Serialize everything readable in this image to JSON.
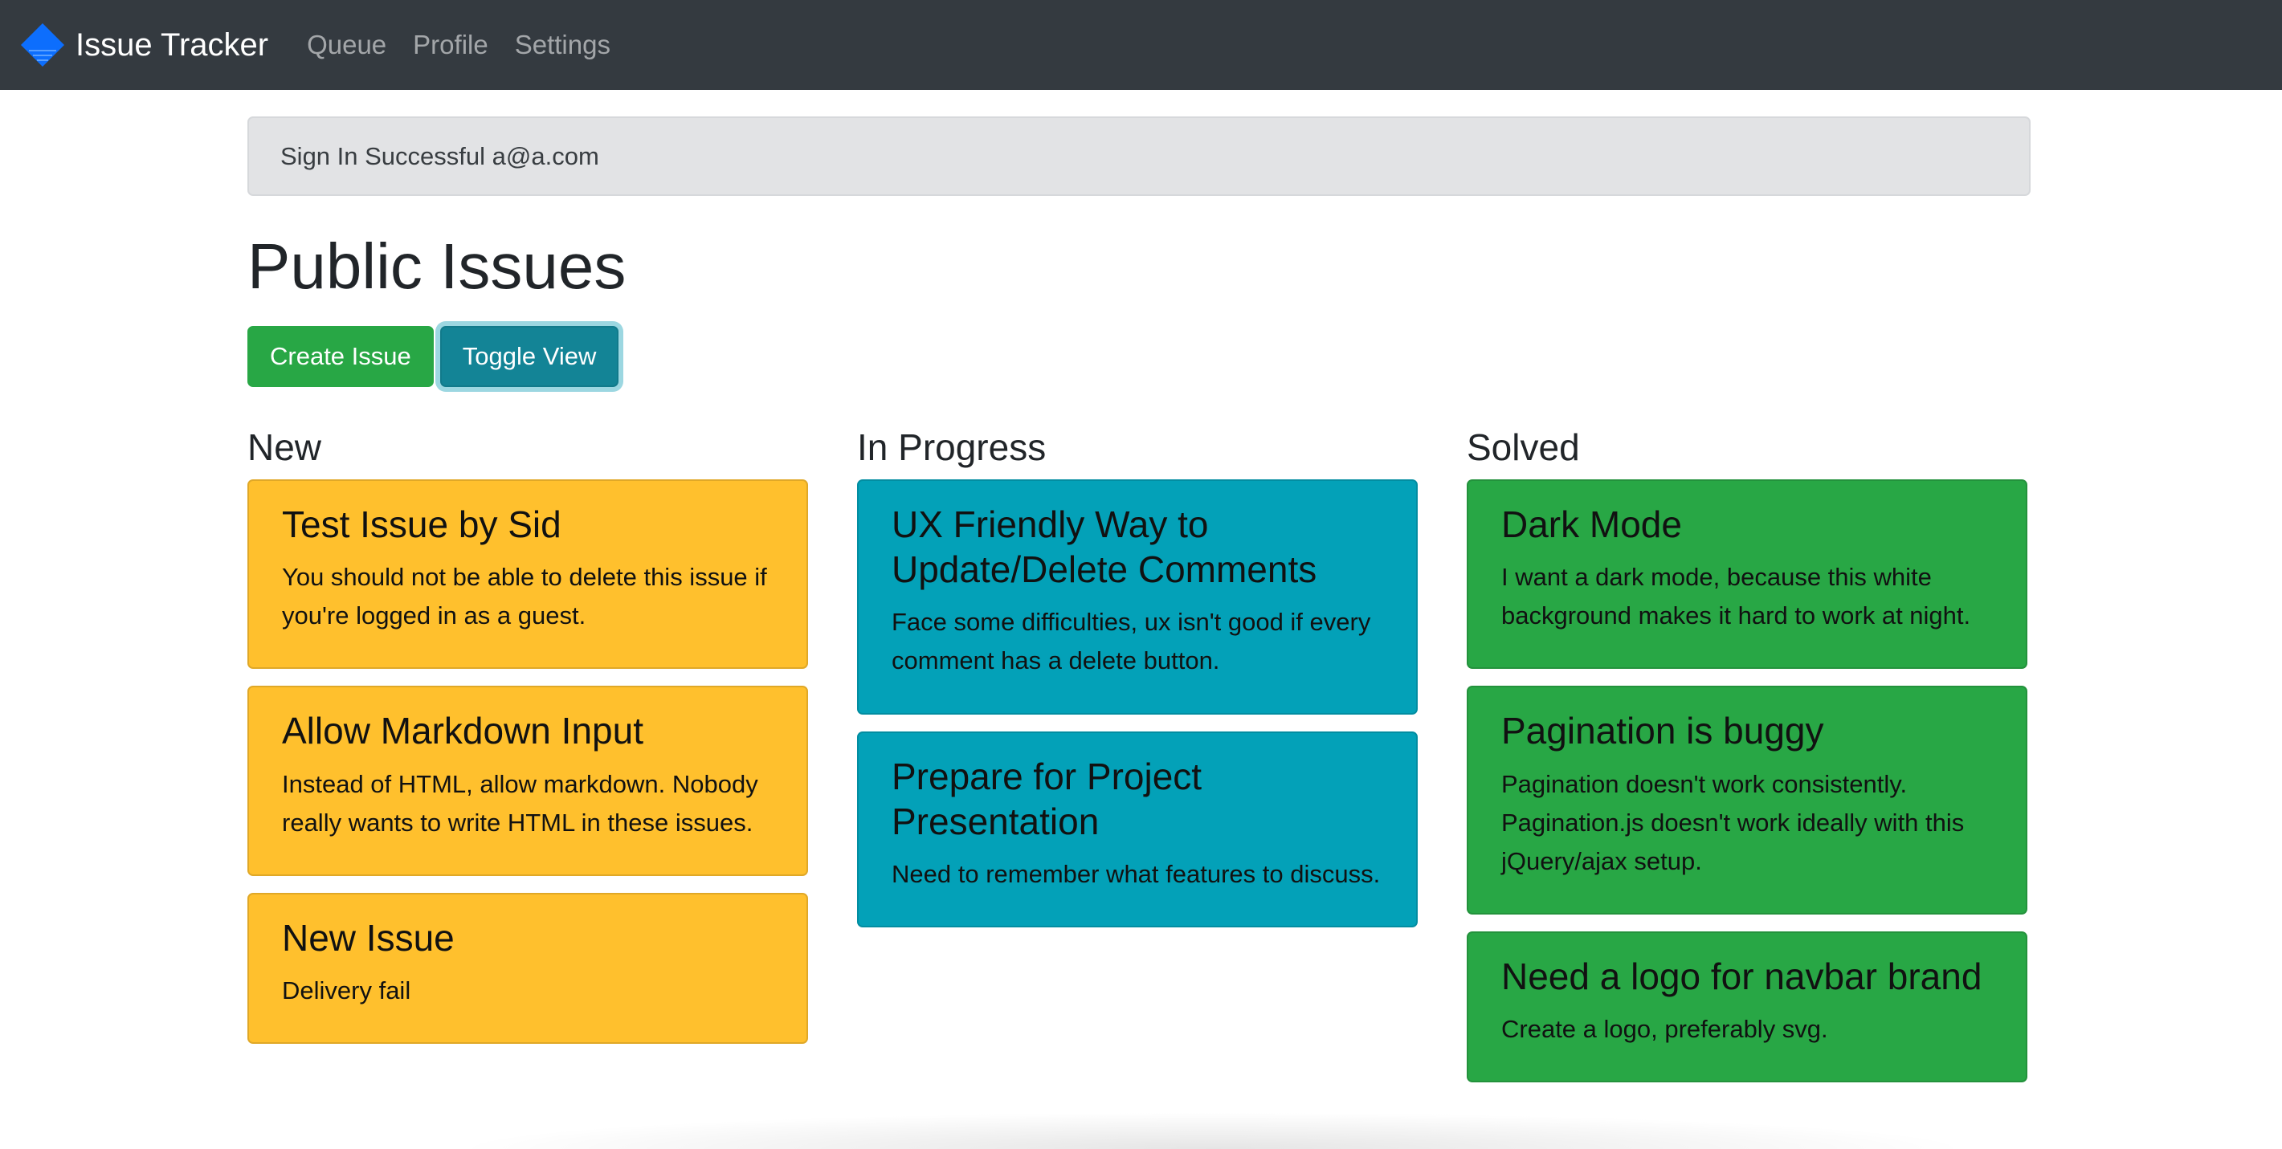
{
  "navbar": {
    "brand": "Issue Tracker",
    "brand_icon": "diamond-logo-icon",
    "brand_color": "#0d6efd",
    "links": [
      "Queue",
      "Profile",
      "Settings"
    ]
  },
  "alert": {
    "text": "Sign In Successful a@a.com"
  },
  "page": {
    "title": "Public Issues"
  },
  "buttons": {
    "create": "Create Issue",
    "toggle": "Toggle View"
  },
  "colors": {
    "navbar_bg": "#343a40",
    "new_card": "#ffc02d",
    "in_progress_card": "#03a1b8",
    "solved_card": "#28a745"
  },
  "columns": [
    {
      "title": "New",
      "issues": [
        {
          "title": "Test Issue by Sid",
          "text": "You should not be able to delete this issue if you're logged in as a guest."
        },
        {
          "title": "Allow Markdown Input",
          "text": "Instead of HTML, allow markdown. Nobody really wants to write HTML in these issues."
        },
        {
          "title": "New Issue",
          "text": "Delivery fail"
        }
      ]
    },
    {
      "title": "In Progress",
      "issues": [
        {
          "title": "UX Friendly Way to Update/Delete Comments",
          "text": "Face some difficulties, ux isn't good if every comment has a delete button."
        },
        {
          "title": "Prepare for Project Presentation",
          "text": "Need to remember what features to discuss."
        }
      ]
    },
    {
      "title": "Solved",
      "issues": [
        {
          "title": "Dark Mode",
          "text": "I want a dark mode, because this white background makes it hard to work at night."
        },
        {
          "title": "Pagination is buggy",
          "text": "Pagination doesn't work consistently. Pagination.js doesn't work ideally with this jQuery/ajax setup."
        },
        {
          "title": "Need a logo for navbar brand",
          "text": "Create a logo, preferably svg."
        }
      ]
    }
  ]
}
